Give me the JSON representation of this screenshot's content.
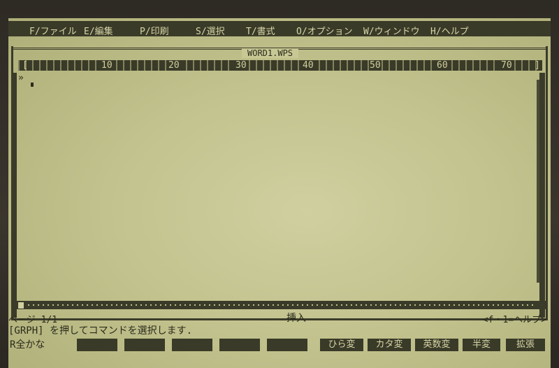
{
  "menu": {
    "items": [
      {
        "label": "F/ファイル"
      },
      {
        "label": "E/編集"
      },
      {
        "label": "P/印刷"
      },
      {
        "label": "S/選択"
      },
      {
        "label": "T/書式"
      },
      {
        "label": "O/オプション"
      },
      {
        "label": "W/ウィンドウ"
      },
      {
        "label": "H/ヘルプ"
      }
    ]
  },
  "window": {
    "title": "WORD1.WPS"
  },
  "ruler": {
    "start": "[",
    "end": "]",
    "marks": [
      "10",
      "20",
      "30",
      "40",
      "50",
      "60",
      "70"
    ]
  },
  "editor": {
    "margin_marker": "»"
  },
  "status": {
    "page": "ページ 1/1",
    "mode": "挿入",
    "help": "<f・1=ヘルプ>"
  },
  "message": "[GRPH] を押してコマンドを選択します.",
  "function_keys": {
    "first": "R全かな",
    "keys": [
      "",
      "",
      "",
      "",
      "",
      "ひら変",
      "カタ変",
      "英数変",
      "半変",
      "拡張"
    ]
  }
}
